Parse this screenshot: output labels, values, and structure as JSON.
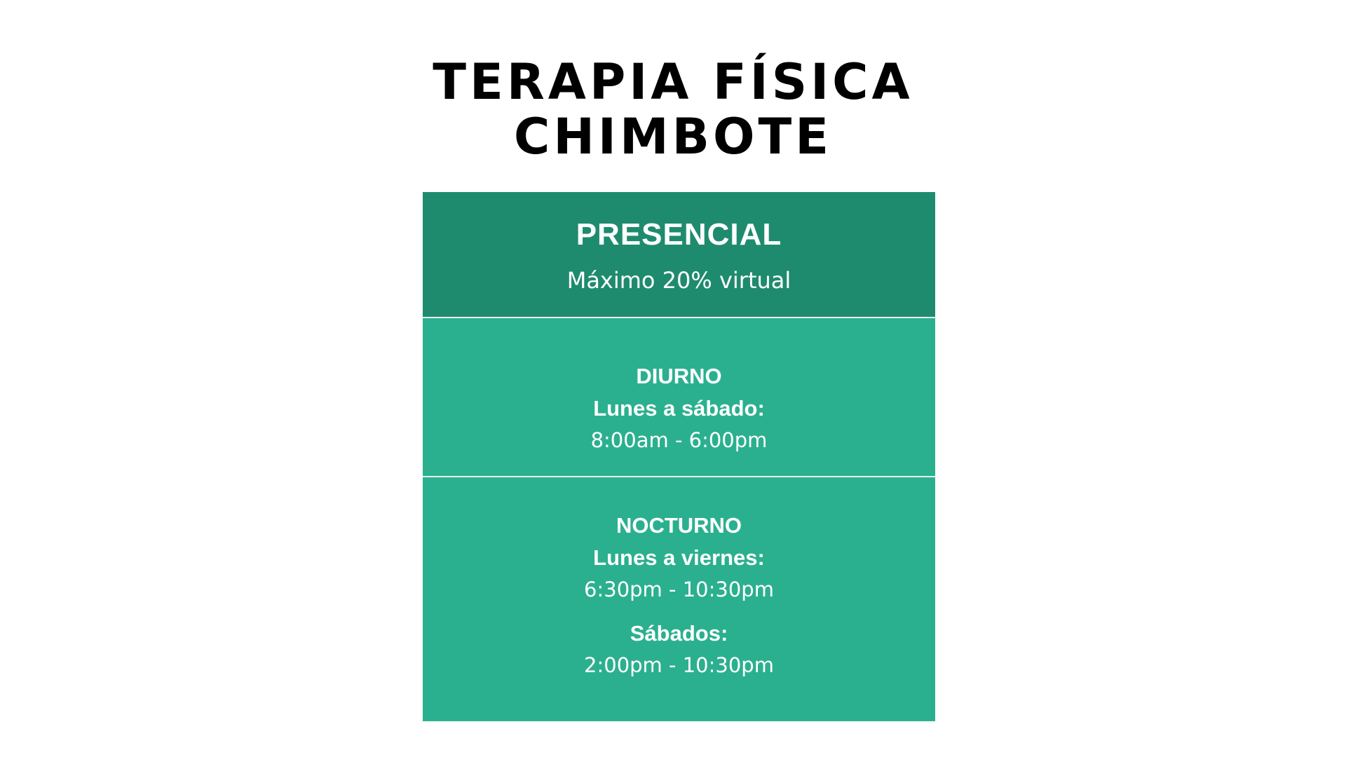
{
  "title": {
    "line1": "TERAPIA FÍSICA",
    "line2": "CHIMBOTE"
  },
  "card": {
    "heading": "PRESENCIAL",
    "subheading": "Máximo 20% virtual",
    "diurno": {
      "label": "DIURNO",
      "days": "Lunes a sábado:",
      "time": "8:00am - 6:00pm"
    },
    "nocturno": {
      "label": "NOCTURNO",
      "weekdays": "Lunes a viernes:",
      "weekdays_time": "6:30pm - 10:30pm",
      "saturday": "Sábados:",
      "saturday_time": "2:00pm - 10:30pm"
    }
  },
  "colors": {
    "header": "#1f8b6e",
    "body": "#2bb08f",
    "text": "#ffffff",
    "title": "#000000"
  }
}
